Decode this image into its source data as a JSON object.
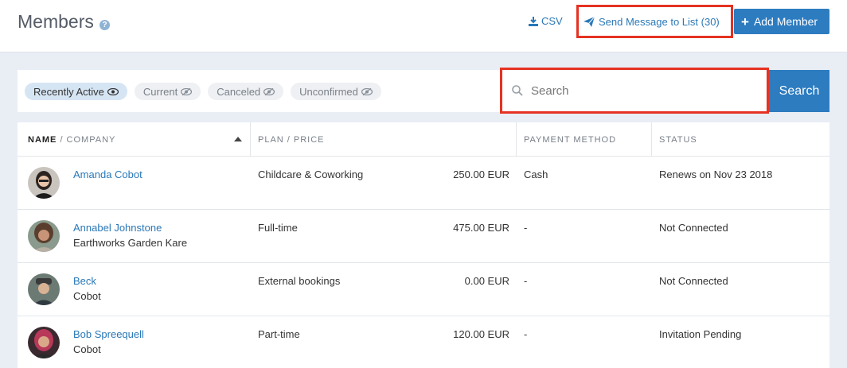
{
  "header": {
    "title": "Members",
    "help_glyph": "?",
    "csv_label": "CSV",
    "send_label": "Send Message to List (30)",
    "add_label": "Add Member"
  },
  "filters": [
    {
      "label": "Recently Active",
      "active": true
    },
    {
      "label": "Current",
      "active": false
    },
    {
      "label": "Canceled",
      "active": false
    },
    {
      "label": "Unconfirmed",
      "active": false
    }
  ],
  "search": {
    "placeholder": "Search",
    "button_label": "Search"
  },
  "table": {
    "headers": {
      "name": "NAME",
      "company": " / COMPANY",
      "plan": "PLAN / PRICE",
      "payment": "PAYMENT METHOD",
      "status": "STATUS"
    },
    "rows": [
      {
        "name": "Amanda Cobot",
        "company": "",
        "plan": "Childcare & Coworking",
        "price": "250.00 EUR",
        "payment": "Cash",
        "status": "Renews on Nov 23 2018"
      },
      {
        "name": "Annabel Johnstone",
        "company": "Earthworks Garden Kare",
        "plan": "Full-time",
        "price": "475.00 EUR",
        "payment": "-",
        "status": "Not Connected"
      },
      {
        "name": "Beck",
        "company": "Cobot",
        "plan": "External bookings",
        "price": "0.00 EUR",
        "payment": "-",
        "status": "Not Connected"
      },
      {
        "name": "Bob Spreequell",
        "company": "Cobot",
        "plan": "Part-time",
        "price": "120.00 EUR",
        "payment": "-",
        "status": "Invitation Pending"
      }
    ]
  },
  "colors": {
    "accent": "#2d7cc0",
    "link": "#2a78b7",
    "highlight": "#e53222"
  }
}
